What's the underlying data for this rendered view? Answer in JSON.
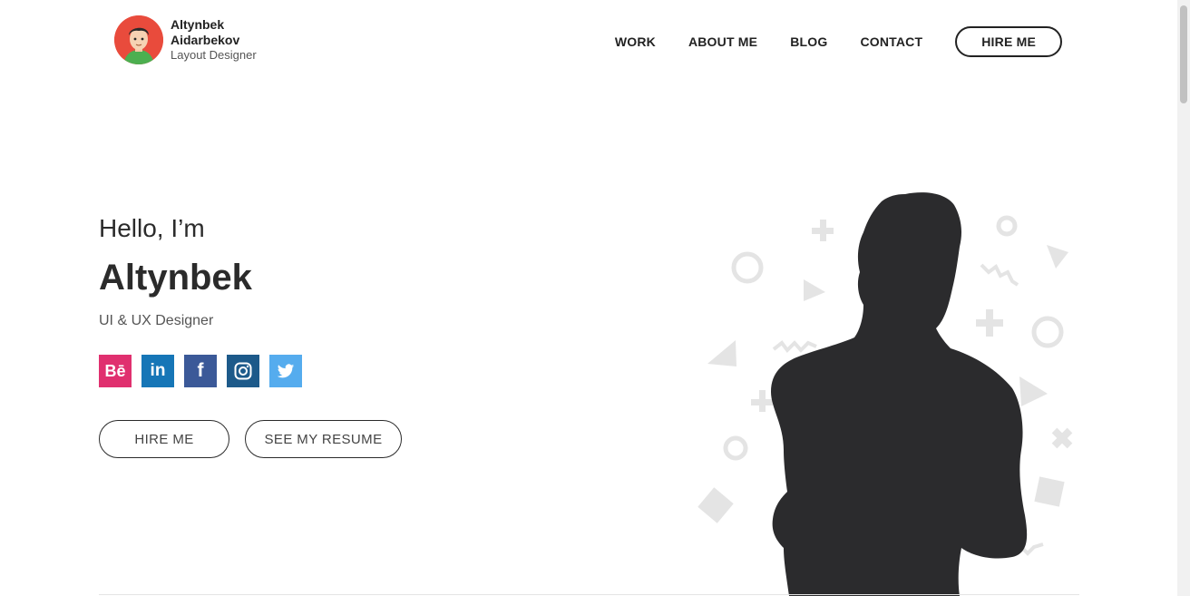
{
  "brand": {
    "name": "Altynbek Aidarbekov",
    "role": "Layout Designer",
    "avatar_icon": "avatar-icon"
  },
  "nav": {
    "items": [
      {
        "label": "WORK"
      },
      {
        "label": "ABOUT ME"
      },
      {
        "label": "BLOG"
      },
      {
        "label": "CONTACT"
      }
    ],
    "hire_label": "HIRE ME"
  },
  "hero": {
    "greeting": "Hello, I’m",
    "name": "Altynbek",
    "role": "UI & UX Designer",
    "socials": [
      {
        "name": "behance",
        "glyph": "Bē",
        "color": "#e0306f"
      },
      {
        "name": "linkedin",
        "glyph": "in",
        "color": "#1676b7"
      },
      {
        "name": "facebook",
        "glyph": "f",
        "color": "#3b5998"
      },
      {
        "name": "instagram",
        "glyph": "instagram",
        "color": "#1d5a8a"
      },
      {
        "name": "twitter",
        "glyph": "twitter",
        "color": "#55acee"
      }
    ],
    "hire_label": "HIRE ME",
    "resume_label": "SEE MY RESUME"
  },
  "colors": {
    "text": "#2b2b2b",
    "silhouette": "#2b2b2d",
    "shapes": "#e6e6e6"
  }
}
